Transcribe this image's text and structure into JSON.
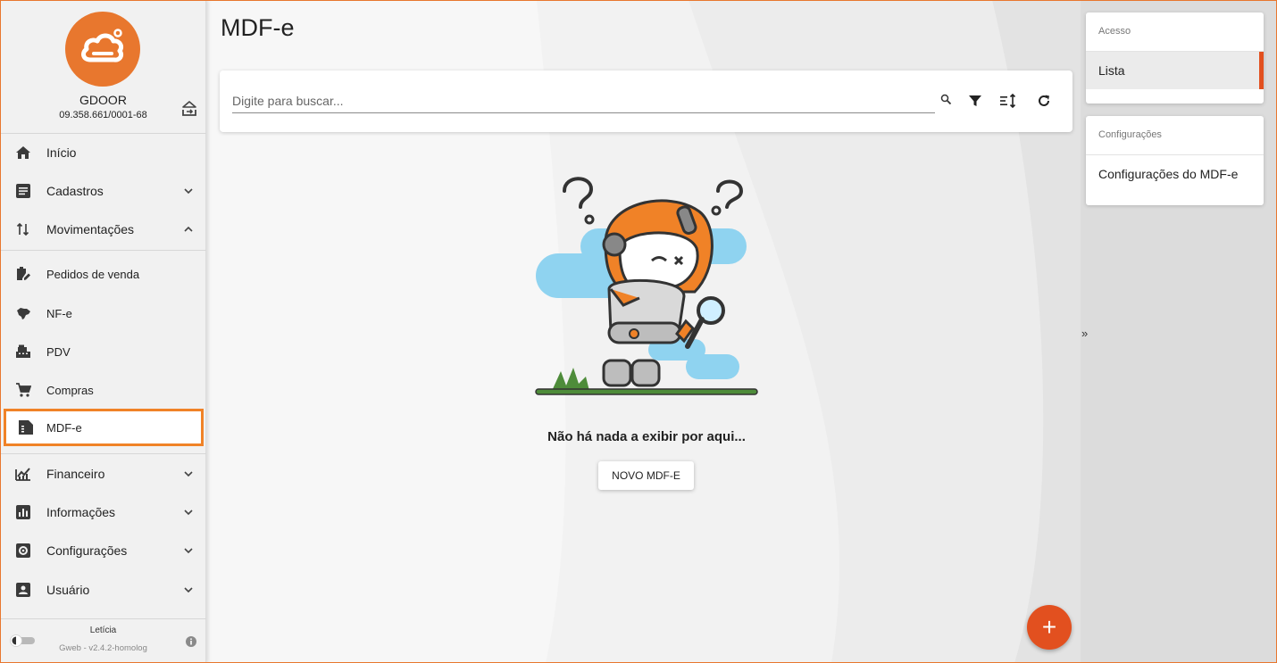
{
  "company": {
    "name": "GDOOR",
    "cnpj": "09.358.661/0001-68",
    "brand_color": "#e8772e"
  },
  "sidebar": {
    "items": [
      {
        "label": "Início",
        "icon": "home-icon"
      },
      {
        "label": "Cadastros",
        "icon": "list-icon",
        "expanded": false
      },
      {
        "label": "Movimentações",
        "icon": "sort-arrows-icon",
        "expanded": true
      },
      {
        "label": "Pedidos de venda",
        "icon": "clipboard-edit-icon"
      },
      {
        "label": "NF-e",
        "icon": "brazil-map-icon"
      },
      {
        "label": "PDV",
        "icon": "cash-register-icon"
      },
      {
        "label": "Compras",
        "icon": "cart-icon"
      },
      {
        "label": "MDF-e",
        "icon": "document-icon",
        "active": true
      },
      {
        "label": "Financeiro",
        "icon": "finance-chart-icon",
        "expanded": false
      },
      {
        "label": "Informações",
        "icon": "bar-chart-icon",
        "expanded": false
      },
      {
        "label": "Configurações",
        "icon": "settings-icon",
        "expanded": false
      },
      {
        "label": "Usuário",
        "icon": "user-box-icon",
        "expanded": false
      }
    ],
    "footer": {
      "user": "Letícia",
      "version": "Gweb - v2.4.2-homolog"
    }
  },
  "main": {
    "title": "MDF-e",
    "search": {
      "placeholder": "Digite para buscar...",
      "value": ""
    },
    "empty_message": "Não há nada a exibir por aqui...",
    "new_button": "NOVO MDF-E",
    "fab_label": "+"
  },
  "right_panel": {
    "toggle": "»",
    "sections": [
      {
        "header": "Acesso",
        "items": [
          {
            "label": "Lista",
            "selected": true
          }
        ]
      },
      {
        "header": "Configurações",
        "items": [
          {
            "label": "Configurações do MDF-e",
            "selected": false
          }
        ]
      }
    ],
    "accent_color": "#e2501f"
  }
}
